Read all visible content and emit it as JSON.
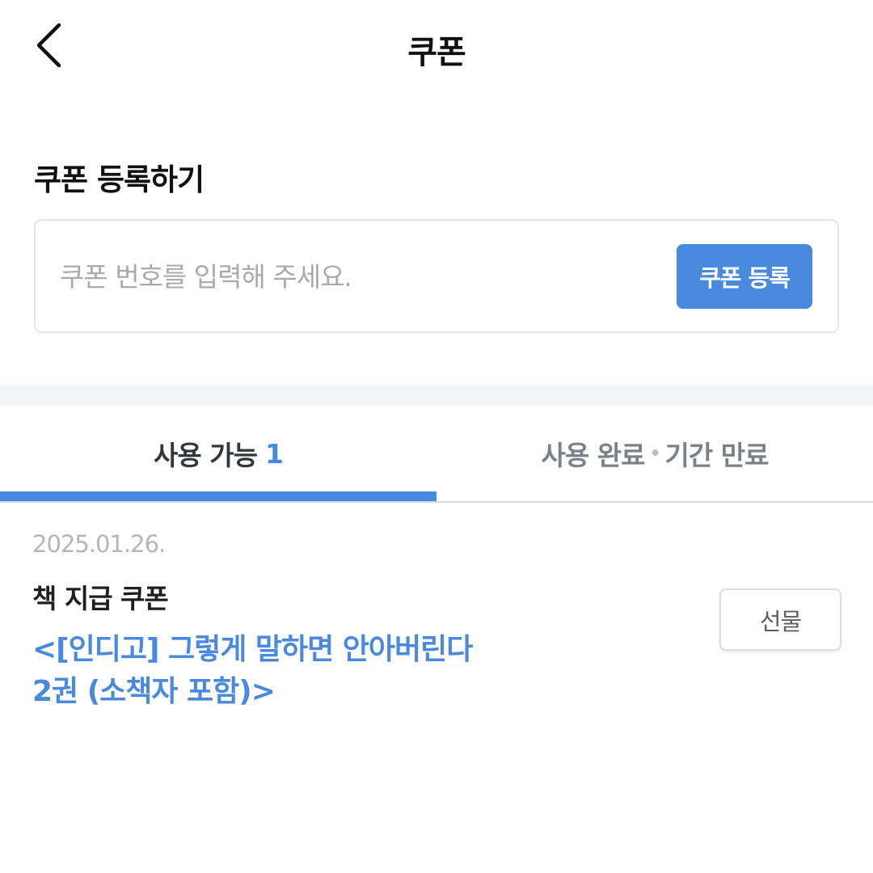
{
  "header": {
    "title": "쿠폰",
    "back_icon": "chevron-left-icon"
  },
  "register": {
    "title": "쿠폰 등록하기",
    "input_placeholder": "쿠폰 번호를 입력해 주세요.",
    "input_value": "",
    "button_label": "쿠폰 등록"
  },
  "tabs": {
    "available": {
      "label": "사용 가능",
      "count": "1"
    },
    "used": {
      "label_left": "사용 완료",
      "separator": "•",
      "label_right": "기간 만료"
    }
  },
  "coupons": [
    {
      "date": "2025.01.26.",
      "name": "책 지급 쿠폰",
      "desc_line1": "<[인디고] 그렇게 말하면 안아버린다",
      "desc_line2": "2권 (소책자 포함)>",
      "gift_label": "선물"
    }
  ],
  "colors": {
    "accent": "#4a8ade",
    "divider": "#f3f4f5",
    "muted_text": "#b4b6ba"
  }
}
